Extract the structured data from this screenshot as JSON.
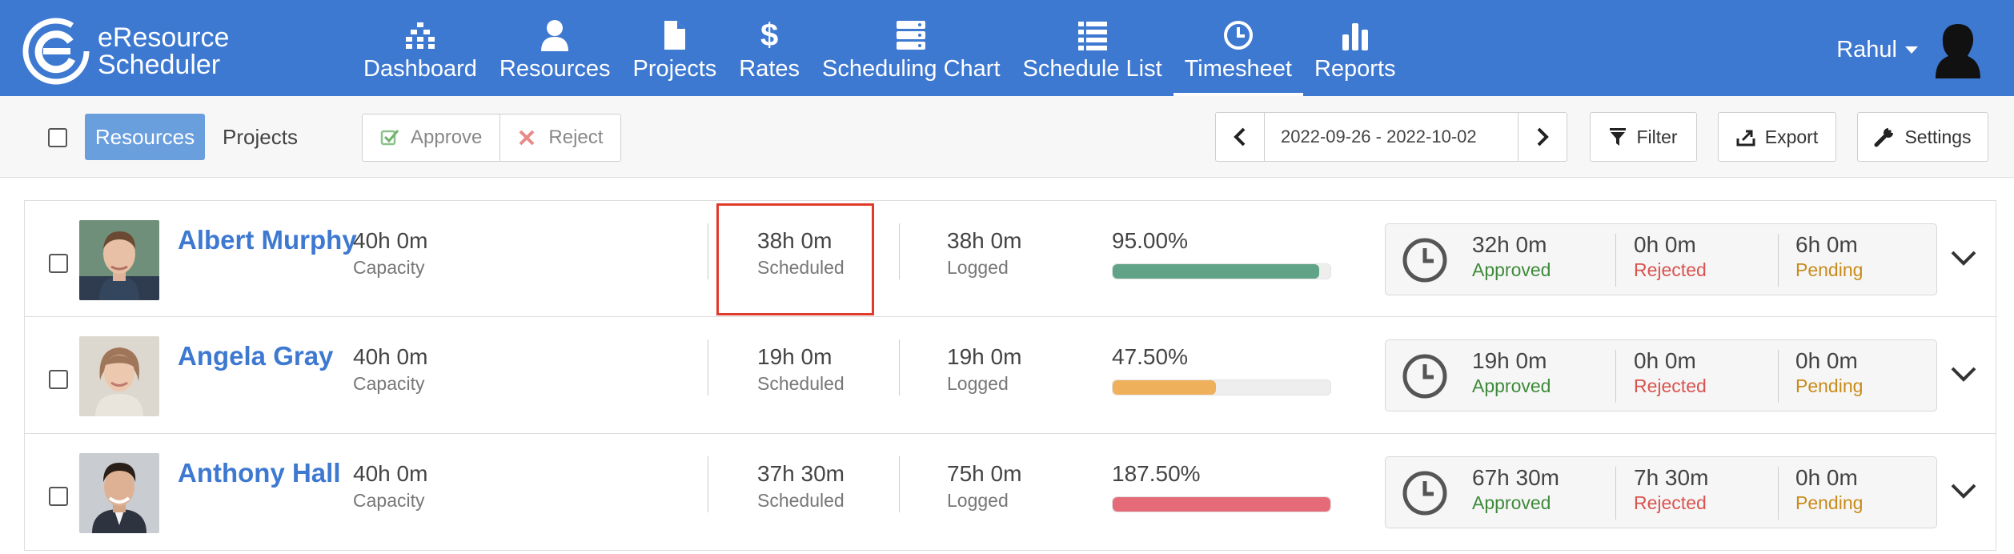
{
  "app": {
    "logo_line1": "eResource",
    "logo_line2": "Scheduler"
  },
  "nav": {
    "items": [
      {
        "label": "Dashboard",
        "icon": "dashboard-icon"
      },
      {
        "label": "Resources",
        "icon": "user-icon"
      },
      {
        "label": "Projects",
        "icon": "file-icon"
      },
      {
        "label": "Rates",
        "icon": "dollar-icon"
      },
      {
        "label": "Scheduling Chart",
        "icon": "server-icon"
      },
      {
        "label": "Schedule List",
        "icon": "list-icon"
      },
      {
        "label": "Timesheet",
        "icon": "clock-icon"
      },
      {
        "label": "Reports",
        "icon": "bar-chart-icon"
      }
    ],
    "active": "Timesheet"
  },
  "user": {
    "name": "Rahul"
  },
  "toolbar": {
    "tabs": [
      "Resources",
      "Projects"
    ],
    "selected_tab": "Resources",
    "approve_label": "Approve",
    "reject_label": "Reject",
    "date_range": "2022-09-26 - 2022-10-02",
    "filter_label": "Filter",
    "export_label": "Export",
    "settings_label": "Settings"
  },
  "resources": [
    {
      "name": "Albert Murphy",
      "capacity": "40h 0m",
      "capacity_label": "Capacity",
      "scheduled": "38h 0m",
      "scheduled_label": "Scheduled",
      "logged": "38h 0m",
      "logged_label": "Logged",
      "percent": "95.00%",
      "percent_value": 95,
      "bar_color": "#61a386",
      "approved": "32h 0m",
      "approved_label": "Approved",
      "rejected": "0h 0m",
      "rejected_label": "Rejected",
      "pending": "6h 0m",
      "pending_label": "Pending"
    },
    {
      "name": "Angela Gray",
      "capacity": "40h 0m",
      "capacity_label": "Capacity",
      "scheduled": "19h 0m",
      "scheduled_label": "Scheduled",
      "logged": "19h 0m",
      "logged_label": "Logged",
      "percent": "47.50%",
      "percent_value": 47.5,
      "bar_color": "#efb05c",
      "approved": "19h 0m",
      "approved_label": "Approved",
      "rejected": "0h 0m",
      "rejected_label": "Rejected",
      "pending": "0h 0m",
      "pending_label": "Pending"
    },
    {
      "name": "Anthony Hall",
      "capacity": "40h 0m",
      "capacity_label": "Capacity",
      "scheduled": "37h 30m",
      "scheduled_label": "Scheduled",
      "logged": "75h 0m",
      "logged_label": "Logged",
      "percent": "187.50%",
      "percent_value": 100,
      "bar_color": "#e56b79",
      "approved": "67h 30m",
      "approved_label": "Approved",
      "rejected": "7h 30m",
      "rejected_label": "Rejected",
      "pending": "0h 0m",
      "pending_label": "Pending"
    }
  ],
  "colors": {
    "header": "#3d78d1",
    "approved": "#3e8a3b",
    "rejected": "#d9534f",
    "pending": "#c98b1a",
    "highlight": "#e03a2b"
  }
}
